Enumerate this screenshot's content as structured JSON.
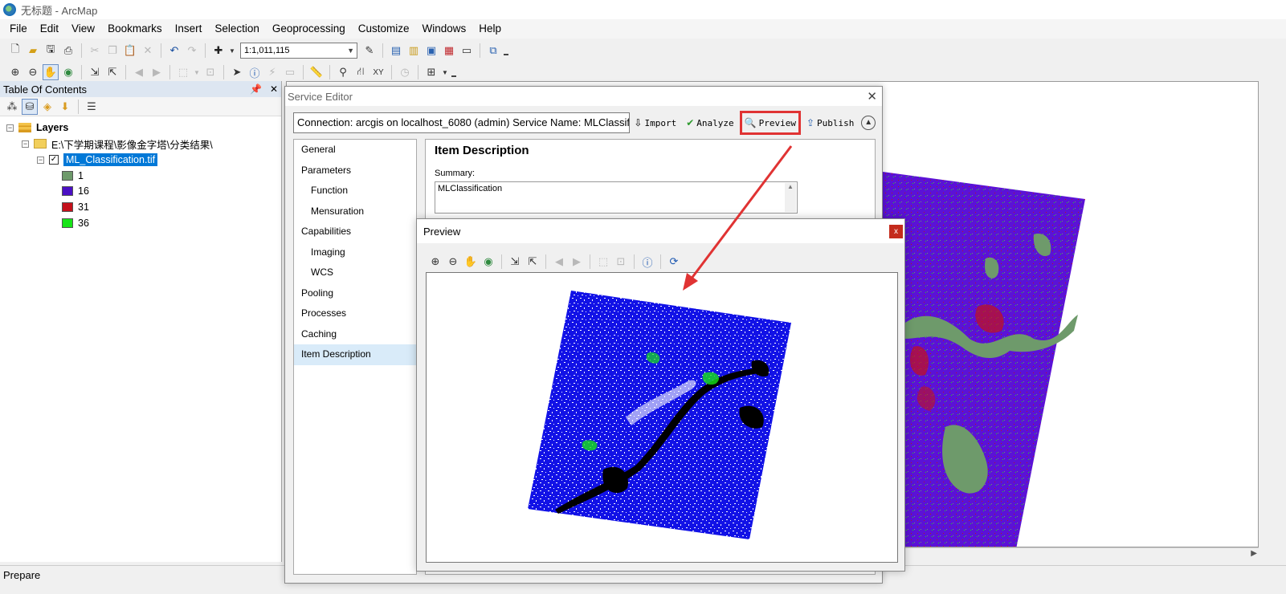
{
  "window": {
    "title": "无标题 - ArcMap"
  },
  "menubar": [
    "File",
    "Edit",
    "View",
    "Bookmarks",
    "Insert",
    "Selection",
    "Geoprocessing",
    "Customize",
    "Windows",
    "Help"
  ],
  "toolbar": {
    "scale": "1:1,011,115"
  },
  "toc": {
    "title": "Table Of Contents",
    "layers_label": "Layers",
    "folder_path": "E:\\下学期课程\\影像金字塔\\分类结果\\",
    "layer_name": "ML_Classification.tif",
    "legend": [
      {
        "label": "1",
        "color": "#6e9a6b"
      },
      {
        "label": "16",
        "color": "#4b0fc4"
      },
      {
        "label": "31",
        "color": "#c4101b"
      },
      {
        "label": "36",
        "color": "#17e417"
      }
    ]
  },
  "status": {
    "text": "Prepare"
  },
  "service_editor": {
    "title": "Service Editor",
    "connection": "Connection: arcgis on localhost_6080 (admin)   Service Name: MLClassifi...",
    "buttons": {
      "import": "Import",
      "analyze": "Analyze",
      "preview": "Preview",
      "publish": "Publish"
    },
    "nav": [
      {
        "label": "General",
        "sub": false
      },
      {
        "label": "Parameters",
        "sub": false
      },
      {
        "label": "Function",
        "sub": true
      },
      {
        "label": "Mensuration",
        "sub": true
      },
      {
        "label": "Capabilities",
        "sub": false
      },
      {
        "label": "Imaging",
        "sub": true
      },
      {
        "label": "WCS",
        "sub": true
      },
      {
        "label": "Pooling",
        "sub": false
      },
      {
        "label": "Processes",
        "sub": false
      },
      {
        "label": "Caching",
        "sub": false
      },
      {
        "label": "Item Description",
        "sub": false,
        "active": true
      }
    ],
    "content": {
      "heading": "Item Description",
      "summary_label": "Summary:",
      "summary_value": "MLClassification"
    }
  },
  "preview": {
    "title": "Preview",
    "close_label": "x"
  },
  "colors": {
    "highlight": "#e03333",
    "selection": "#0078d7",
    "blue_raster": "#1010e0",
    "purple_raster": "#5a10d8"
  }
}
